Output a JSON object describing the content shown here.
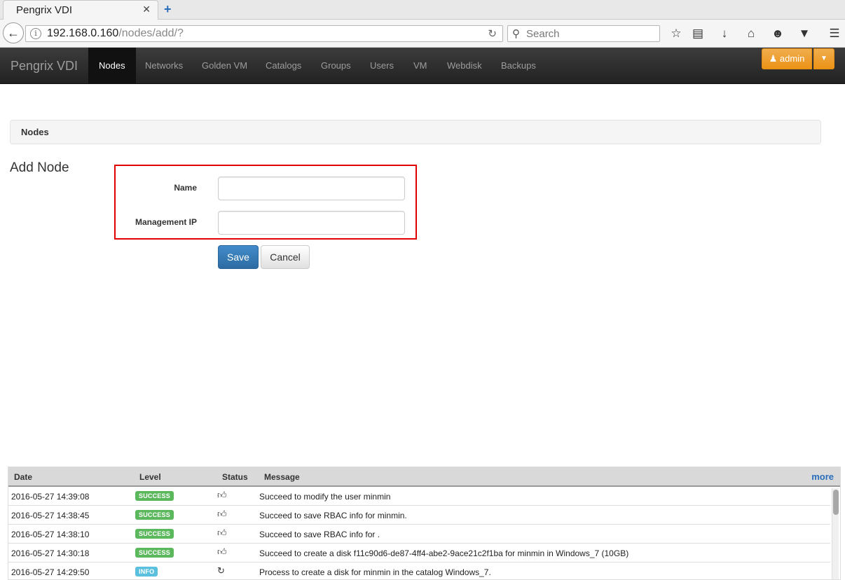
{
  "browser": {
    "tab_title": "Pengrix VDI",
    "tab_close": "✕",
    "new_tab": "+",
    "url_host": "192.168.0.160",
    "url_path": "/nodes/add/?",
    "search_placeholder": "Search"
  },
  "nav": {
    "brand": "Pengrix VDI",
    "items": [
      "Nodes",
      "Networks",
      "Golden VM",
      "Catalogs",
      "Groups",
      "Users",
      "VM",
      "Webdisk",
      "Backups"
    ],
    "user": "admin"
  },
  "breadcrumb": "Nodes",
  "page": {
    "title": "Add Node",
    "name_label": "Name",
    "name_value": "",
    "mgmt_label": "Management IP",
    "mgmt_value": "",
    "save": "Save",
    "cancel": "Cancel"
  },
  "log": {
    "headers": [
      "Date",
      "Level",
      "Status",
      "Message"
    ],
    "more": "more",
    "rows": [
      {
        "date": "2016-05-27 14:39:08",
        "level": "SUCCESS",
        "status_icon": "thumbs-up-icon",
        "message": "Succeed to modify the user minmin"
      },
      {
        "date": "2016-05-27 14:38:45",
        "level": "SUCCESS",
        "status_icon": "thumbs-up-icon",
        "message": "Succeed to save RBAC info for minmin."
      },
      {
        "date": "2016-05-27 14:38:10",
        "level": "SUCCESS",
        "status_icon": "thumbs-up-icon",
        "message": "Succeed to save RBAC info for ."
      },
      {
        "date": "2016-05-27 14:30:18",
        "level": "SUCCESS",
        "status_icon": "thumbs-up-icon",
        "message": "Succeed to create a disk f11c90d6-de87-4ff4-abe2-9ace21c2f1ba for minmin in Windows_7 (10GB)"
      },
      {
        "date": "2016-05-27 14:29:50",
        "level": "INFO",
        "status_icon": "refresh-icon",
        "message": "Process to create a disk for minmin in the catalog Windows_7."
      }
    ]
  },
  "colors": {
    "accent": "#e00000",
    "primary": "#428bca",
    "warning": "#f0ad4e",
    "success": "#5cb85c",
    "info": "#5bc0de"
  }
}
